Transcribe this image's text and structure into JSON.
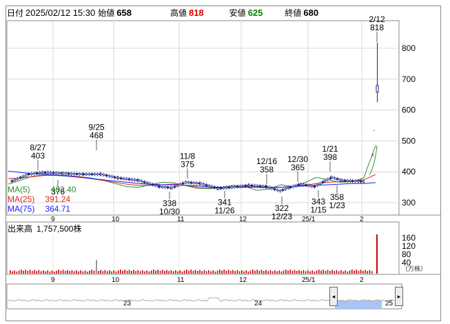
{
  "header": {
    "date_label": "日付",
    "date_value": "2025/02/12 15:30",
    "open_label": "始値",
    "open_value": "658",
    "high_label": "高値",
    "high_value": "818",
    "low_label": "安値",
    "low_value": "625",
    "close_label": "終値",
    "close_value": "680"
  },
  "legend": {
    "ma5_label": "MA(5)",
    "ma5_value": "483.40",
    "ma25_label": "MA(25)",
    "ma25_value": "391.24",
    "ma75_label": "MA(75)",
    "ma75_value": "364.71"
  },
  "colors": {
    "up": "#e00000",
    "down": "#008000",
    "ma5": "#2e8b2e",
    "ma25": "#e02020",
    "ma75": "#1a1aff",
    "candle_up": "#ffffff",
    "candle_down": "#1a237e",
    "volume": "#cc0000"
  },
  "price_axis": [
    "800",
    "700",
    "600",
    "500",
    "400",
    "300"
  ],
  "date_axis": [
    "9",
    "10",
    "11",
    "12",
    "25/1",
    "2"
  ],
  "volume": {
    "title": "出来高",
    "value": "1,757,500株",
    "axis": [
      "160",
      "120",
      "80",
      "40"
    ],
    "unit": "（万株）"
  },
  "annotations": [
    {
      "id": "ann-827",
      "date": "8/27",
      "price": "403"
    },
    {
      "id": "ann-925",
      "date": "9/25",
      "price": "468"
    },
    {
      "id": "ann-1108",
      "date": "11/8",
      "price": "375"
    },
    {
      "id": "ann-1216",
      "date": "12/16",
      "price": "358"
    },
    {
      "id": "ann-1230",
      "date": "12/30",
      "price": "365"
    },
    {
      "id": "ann-0121",
      "date": "1/21",
      "price": "398"
    },
    {
      "id": "ann-0212",
      "date": "2/12",
      "price": "818"
    },
    {
      "id": "ann-1030",
      "date": "10/30",
      "price": "338"
    },
    {
      "id": "ann-1126",
      "date": "11/26",
      "price": "341"
    },
    {
      "id": "ann-1223",
      "date": "12/23",
      "price": "322"
    },
    {
      "id": "ann-0115",
      "date": "1/15",
      "price": "343"
    },
    {
      "id": "ann-0123",
      "date": "1/23",
      "price": "358"
    },
    {
      "id": "ann-0903",
      "date": "",
      "price": "376"
    }
  ],
  "navigator": {
    "labels": [
      "23",
      "24",
      "25"
    ]
  },
  "chart_data": {
    "type": "line",
    "title": "",
    "ylim": [
      270,
      830
    ],
    "series": [
      {
        "name": "MA(5)",
        "values": [
          360,
          372,
          385,
          390,
          388,
          386,
          384,
          380,
          372,
          362,
          352,
          350,
          358,
          366,
          364,
          355,
          346,
          345,
          350,
          356,
          352,
          340,
          344,
          358,
          352,
          364,
          382,
          374,
          366,
          368,
          380,
          485
        ]
      },
      {
        "name": "MA(25)",
        "values": [
          378,
          380,
          384,
          388,
          389,
          388,
          384,
          378,
          372,
          366,
          360,
          356,
          356,
          358,
          360,
          356,
          350,
          348,
          348,
          350,
          352,
          350,
          348,
          350,
          352,
          356,
          362,
          366,
          368,
          370,
          374,
          391
        ]
      },
      {
        "name": "MA(75)",
        "values": [
          402,
          398,
          394,
          392,
          390,
          386,
          382,
          378,
          374,
          370,
          366,
          362,
          360,
          358,
          358,
          356,
          354,
          352,
          350,
          350,
          350,
          350,
          350,
          350,
          352,
          354,
          356,
          358,
          360,
          362,
          362,
          365
        ]
      }
    ]
  }
}
